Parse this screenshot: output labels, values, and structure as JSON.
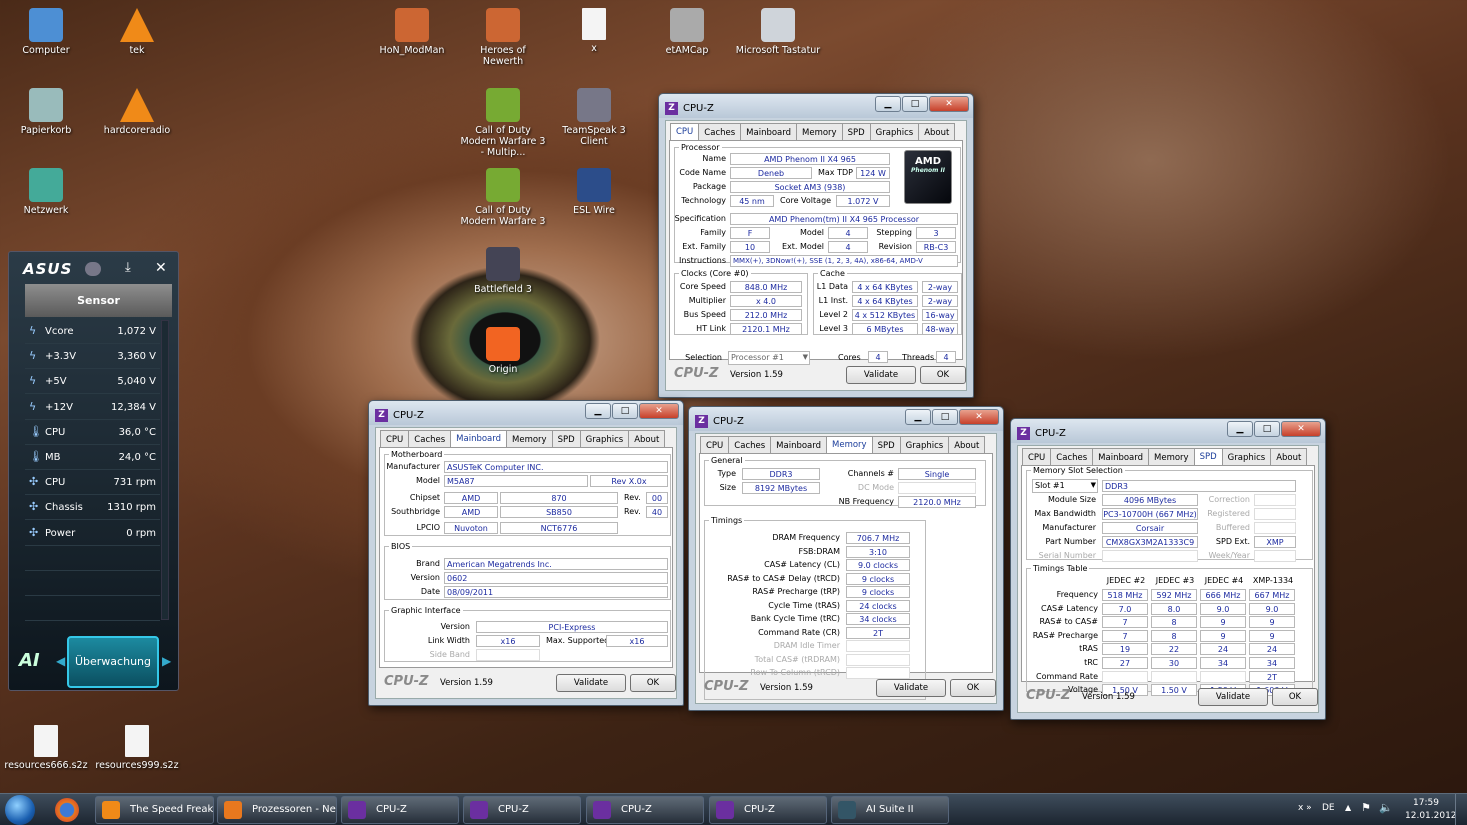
{
  "desktop_icons": [
    {
      "label": "Computer",
      "x": "computer-icon"
    },
    {
      "label": "tek",
      "x": "vlc-icon"
    },
    {
      "label": "HoN_ModMan",
      "x": "hon-icon"
    },
    {
      "label": "Heroes of Newerth",
      "x": "hon-icon"
    },
    {
      "label": "x",
      "x": "file-icon"
    },
    {
      "label": "etAMCap",
      "x": "app-icon"
    },
    {
      "label": "Microsoft Tastatur",
      "x": "keyboard-icon"
    },
    {
      "label": "Papierkorb",
      "x": "recycle-bin-icon"
    },
    {
      "label": "hardcoreradio",
      "x": "vlc-icon"
    },
    {
      "label": "Call of Duty Modern Warfare 3 - Multip...",
      "x": "cod-icon"
    },
    {
      "label": "TeamSpeak 3 Client",
      "x": "teamspeak-icon"
    },
    {
      "label": "Netzwerk",
      "x": "network-icon"
    },
    {
      "label": "Call of Duty Modern Warfare 3",
      "x": "cod-icon"
    },
    {
      "label": "ESL Wire",
      "x": "esl-icon"
    },
    {
      "label": "Battlefield 3",
      "x": "battlefield-icon"
    },
    {
      "label": "Origin",
      "x": "origin-icon"
    },
    {
      "label": "resources666.s2z",
      "x": "file-icon"
    },
    {
      "label": "resources999.s2z",
      "x": "file-icon"
    }
  ],
  "cpuz_common": {
    "app_title": "CPU-Z",
    "brand": "CPU-Z",
    "version": "Version 1.59",
    "validate": "Validate",
    "ok": "OK",
    "tabs": [
      "CPU",
      "Caches",
      "Mainboard",
      "Memory",
      "SPD",
      "Graphics",
      "About"
    ]
  },
  "cpu": {
    "processor_legend": "Processor",
    "name_l": "Name",
    "name": "AMD Phenom II X4 965",
    "code_l": "Code Name",
    "code": "Deneb",
    "tdp_l": "Max TDP",
    "tdp": "124 W",
    "package_l": "Package",
    "package": "Socket AM3 (938)",
    "tech_l": "Technology",
    "tech": "45 nm",
    "cv_l": "Core Voltage",
    "cv": "1.072 V",
    "spec_l": "Specification",
    "spec": "AMD Phenom(tm) II X4 965 Processor",
    "family_l": "Family",
    "family": "F",
    "model_l": "Model",
    "model": "4",
    "stepping_l": "Stepping",
    "stepping": "3",
    "extfam_l": "Ext. Family",
    "extfam": "10",
    "extmod_l": "Ext. Model",
    "extmod": "4",
    "rev_l": "Revision",
    "rev": "RB-C3",
    "instr_l": "Instructions",
    "instr": "MMX(+), 3DNow!(+), SSE (1, 2, 3, 4A), x86-64, AMD-V",
    "logo_brand": "AMD",
    "logo_sub": "Phenom II",
    "clocks_legend": "Clocks (Core #0)",
    "cs_l": "Core Speed",
    "cs": "848.0 MHz",
    "mul_l": "Multiplier",
    "mul": "x 4.0",
    "bus_l": "Bus Speed",
    "bus": "212.0 MHz",
    "ht_l": "HT Link",
    "ht": "2120.1 MHz",
    "cache_legend": "Cache",
    "l1d_l": "L1 Data",
    "l1d": "4 x 64 KBytes",
    "l1d_w": "2-way",
    "l1i_l": "L1 Inst.",
    "l1i": "4 x 64 KBytes",
    "l1i_w": "2-way",
    "l2_l": "Level 2",
    "l2": "4 x 512 KBytes",
    "l2_w": "16-way",
    "l3_l": "Level 3",
    "l3": "6 MBytes",
    "l3_w": "48-way",
    "sel_l": "Selection",
    "sel": "Processor #1",
    "cores_l": "Cores",
    "cores": "4",
    "threads_l": "Threads",
    "threads": "4"
  },
  "mainboard": {
    "mb_legend": "Motherboard",
    "manu_l": "Manufacturer",
    "manu": "ASUSTeK Computer INC.",
    "model_l": "Model",
    "model": "M5A87",
    "model_rev": "Rev X.0x",
    "chipset_l": "Chipset",
    "chipset_v": "AMD",
    "chipset_m": "870",
    "rev_l": "Rev.",
    "chipset_r": "00",
    "south_l": "Southbridge",
    "south_v": "AMD",
    "south_m": "SB850",
    "south_r": "40",
    "lpcio_l": "LPCIO",
    "lpcio_v": "Nuvoton",
    "lpcio_m": "NCT6776",
    "bios_legend": "BIOS",
    "brand_l": "Brand",
    "brand": "American Megatrends Inc.",
    "ver_l": "Version",
    "ver": "0602",
    "date_l": "Date",
    "date": "08/09/2011",
    "gi_legend": "Graphic Interface",
    "giver_l": "Version",
    "giver": "PCI-Express",
    "lw_l": "Link Width",
    "lw": "x16",
    "ms_l": "Max. Supported",
    "ms": "x16",
    "sb_l": "Side Band"
  },
  "memory": {
    "gen_legend": "General",
    "type_l": "Type",
    "type": "DDR3",
    "ch_l": "Channels #",
    "ch": "Single",
    "size_l": "Size",
    "size": "8192 MBytes",
    "dc_l": "DC Mode",
    "nb_l": "NB Frequency",
    "nb": "2120.0 MHz",
    "tim_legend": "Timings",
    "rows": [
      {
        "l": "DRAM Frequency",
        "v": "706.7 MHz"
      },
      {
        "l": "FSB:DRAM",
        "v": "3:10"
      },
      {
        "l": "CAS# Latency (CL)",
        "v": "9.0 clocks"
      },
      {
        "l": "RAS# to CAS# Delay (tRCD)",
        "v": "9 clocks"
      },
      {
        "l": "RAS# Precharge (tRP)",
        "v": "9 clocks"
      },
      {
        "l": "Cycle Time (tRAS)",
        "v": "24 clocks"
      },
      {
        "l": "Bank Cycle Time (tRC)",
        "v": "34 clocks"
      },
      {
        "l": "Command Rate (CR)",
        "v": "2T"
      }
    ],
    "grey": [
      "DRAM Idle Timer",
      "Total CAS# (tRDRAM)",
      "Row To Column (tRCD)"
    ]
  },
  "spd": {
    "slot_legend": "Memory Slot Selection",
    "slot": "Slot #1",
    "slot_type": "DDR3",
    "msize_l": "Module Size",
    "msize": "4096 MBytes",
    "corr_l": "Correction",
    "bw_l": "Max Bandwidth",
    "bw": "PC3-10700H (667 MHz)",
    "reg_l": "Registered",
    "manu_l": "Manufacturer",
    "manu": "Corsair",
    "buf_l": "Buffered",
    "pn_l": "Part Number",
    "pn": "CMX8GX3M2A1333C9",
    "spdext_l": "SPD Ext.",
    "spdext": "XMP",
    "sn_l": "Serial Number",
    "wy_l": "Week/Year",
    "tt_legend": "Timings Table",
    "cols": [
      "JEDEC #2",
      "JEDEC #3",
      "JEDEC #4",
      "XMP-1334"
    ],
    "rows": [
      {
        "l": "Frequency",
        "v": [
          "518 MHz",
          "592 MHz",
          "666 MHz",
          "667 MHz"
        ]
      },
      {
        "l": "CAS# Latency",
        "v": [
          "7.0",
          "8.0",
          "9.0",
          "9.0"
        ]
      },
      {
        "l": "RAS# to CAS#",
        "v": [
          "7",
          "8",
          "9",
          "9"
        ]
      },
      {
        "l": "RAS# Precharge",
        "v": [
          "7",
          "8",
          "9",
          "9"
        ]
      },
      {
        "l": "tRAS",
        "v": [
          "19",
          "22",
          "24",
          "24"
        ]
      },
      {
        "l": "tRC",
        "v": [
          "27",
          "30",
          "34",
          "34"
        ]
      },
      {
        "l": "Command Rate",
        "v": [
          "",
          "",
          "",
          "2T"
        ]
      },
      {
        "l": "Voltage",
        "v": [
          "1.50 V",
          "1.50 V",
          "1.50 V",
          "1.600 V"
        ]
      }
    ]
  },
  "asus": {
    "logo": "ASUS",
    "sensor": "Sensor",
    "ai": "AI",
    "button": "Überwachung",
    "rows": [
      {
        "n": "Vcore",
        "v": "1,072  V",
        "i": "bolt-icon"
      },
      {
        "n": "+3.3V",
        "v": "3,360  V",
        "i": "bolt-icon"
      },
      {
        "n": "+5V",
        "v": "5,040  V",
        "i": "bolt-icon"
      },
      {
        "n": "+12V",
        "v": "12,384  V",
        "i": "bolt-icon"
      },
      {
        "n": "CPU",
        "v": "36,0 °C",
        "i": "thermometer-icon"
      },
      {
        "n": "MB",
        "v": "24,0 °C",
        "i": "thermometer-icon"
      },
      {
        "n": "CPU",
        "v": "731  rpm",
        "i": "fan-icon"
      },
      {
        "n": "Chassis",
        "v": "1310  rpm",
        "i": "fan-icon"
      },
      {
        "n": "Power",
        "v": "0  rpm",
        "i": "fan-icon"
      }
    ]
  },
  "taskbar": {
    "items": [
      "The Speed Freak -...",
      "Prozessoren - Ne...",
      "CPU-Z",
      "CPU-Z",
      "CPU-Z",
      "CPU-Z",
      "AI Suite II"
    ],
    "lang": "DE",
    "time": "17:59",
    "date": "12.01.2012"
  }
}
